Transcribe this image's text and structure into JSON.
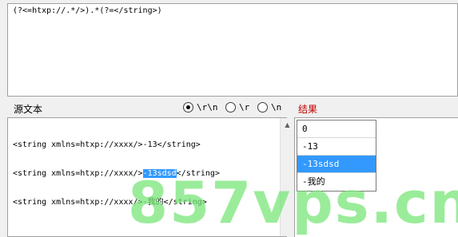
{
  "regex": {
    "pattern": "(?<=htxp://.*/>).*(?=</string>)"
  },
  "source": {
    "label": "源文本",
    "lines": [
      {
        "before": "<string xmlns=htxp://xxxx/>",
        "highlight": "",
        "after": "-13</string>"
      },
      {
        "before": "<string xmlns=htxp://xxxx/>",
        "highlight": "-13sdsd",
        "after": "</string>"
      },
      {
        "before": "<string xmlns=htxp://xxxx/>",
        "highlight": "",
        "after": "-我的</string>"
      }
    ]
  },
  "line_ending": {
    "options": [
      {
        "label": "\\r\\n",
        "checked": true
      },
      {
        "label": "\\r",
        "checked": false
      },
      {
        "label": "\\n",
        "checked": false
      }
    ]
  },
  "result": {
    "label": "结果",
    "items": [
      {
        "text": "0",
        "selected": false
      },
      {
        "text": "-13",
        "selected": false
      },
      {
        "text": "-13sdsd",
        "selected": true
      },
      {
        "text": "-我的",
        "selected": false
      }
    ]
  },
  "watermark": {
    "text": "857vps.cn"
  },
  "colors": {
    "selection": "#3399ff",
    "result_label": "#c00000",
    "watermark": "#78e678"
  }
}
